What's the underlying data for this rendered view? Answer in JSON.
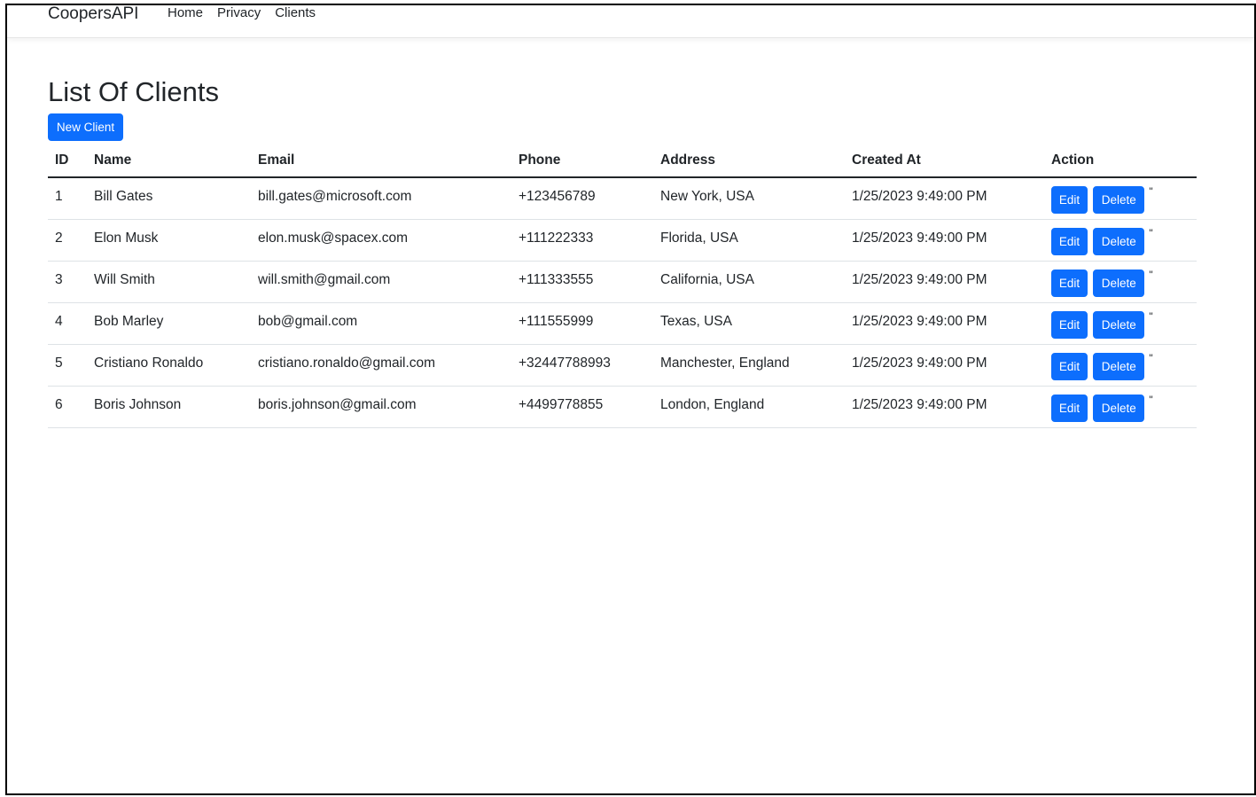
{
  "navbar": {
    "brand": "CoopersAPI",
    "links": [
      "Home",
      "Privacy",
      "Clients"
    ]
  },
  "page": {
    "title": "List Of Clients",
    "new_button_label": "New Client"
  },
  "table": {
    "headers": [
      "ID",
      "Name",
      "Email",
      "Phone",
      "Address",
      "Created At",
      "Action"
    ],
    "rows": [
      {
        "id": "1",
        "name": "Bill Gates",
        "email": "bill.gates@microsoft.com",
        "phone": "+123456789",
        "address": "New York, USA",
        "created_at": "1/25/2023 9:49:00 PM"
      },
      {
        "id": "2",
        "name": "Elon Musk",
        "email": "elon.musk@spacex.com",
        "phone": "+111222333",
        "address": "Florida, USA",
        "created_at": "1/25/2023 9:49:00 PM"
      },
      {
        "id": "3",
        "name": "Will Smith",
        "email": "will.smith@gmail.com",
        "phone": "+111333555",
        "address": "California, USA",
        "created_at": "1/25/2023 9:49:00 PM"
      },
      {
        "id": "4",
        "name": "Bob Marley",
        "email": "bob@gmail.com",
        "phone": "+111555999",
        "address": "Texas, USA",
        "created_at": "1/25/2023 9:49:00 PM"
      },
      {
        "id": "5",
        "name": "Cristiano Ronaldo",
        "email": "cristiano.ronaldo@gmail.com",
        "phone": "+32447788993",
        "address": "Manchester, England",
        "created_at": "1/25/2023 9:49:00 PM"
      },
      {
        "id": "6",
        "name": "Boris Johnson",
        "email": "boris.johnson@gmail.com",
        "phone": "+4499778855",
        "address": "London, England",
        "created_at": "1/25/2023 9:49:00 PM"
      }
    ],
    "edit_label": "Edit",
    "delete_label": "Delete",
    "stray_text": "\""
  },
  "colors": {
    "primary": "#0d6efd",
    "text": "#212529",
    "row_border": "#dee2e6"
  }
}
